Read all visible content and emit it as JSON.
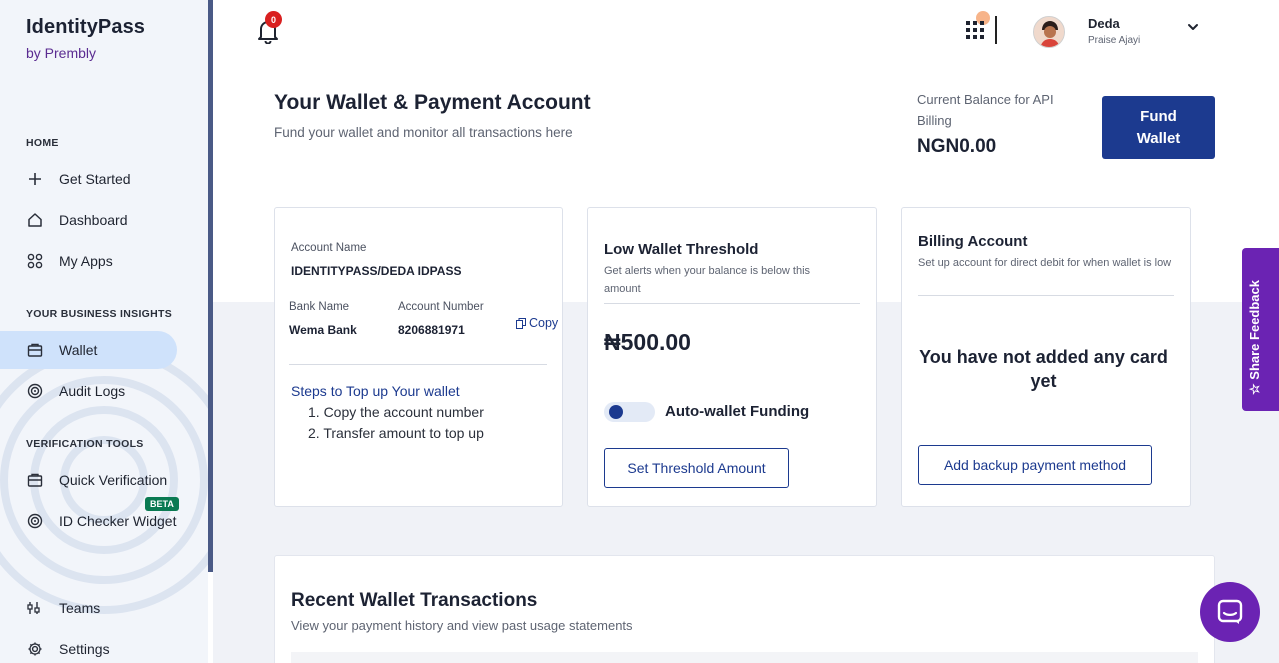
{
  "brand": {
    "name": "IdentityPass",
    "by": "by Prembly"
  },
  "sidebar": {
    "sections": {
      "home": "HOME",
      "insights": "YOUR BUSINESS INSIGHTS",
      "verification": "VERIFICATION TOOLS"
    },
    "items": [
      {
        "label": "Get Started",
        "icon": "plus-icon"
      },
      {
        "label": "Dashboard",
        "icon": "home-icon"
      },
      {
        "label": "My Apps",
        "icon": "apps-icon"
      },
      {
        "label": "Wallet",
        "icon": "wallet-icon",
        "active": true
      },
      {
        "label": "Audit Logs",
        "icon": "target-icon"
      },
      {
        "label": "Quick Verification",
        "icon": "briefcase-icon"
      },
      {
        "label": "ID Checker Widget",
        "icon": "target-icon"
      },
      {
        "label": "Teams",
        "icon": "teams-icon"
      },
      {
        "label": "Settings",
        "icon": "gear-icon"
      }
    ],
    "beta": "BETA"
  },
  "topbar": {
    "notification_count": "0",
    "user_name": "Deda",
    "user_sub": "Praise Ajayi"
  },
  "header": {
    "title": "Your Wallet & Payment Account",
    "subtitle": "Fund your wallet and monitor all transactions here",
    "balance_label": "Current Balance for API Billing",
    "balance_value": "NGN0.00",
    "fund_button": "Fund Wallet"
  },
  "account_card": {
    "account_name_label": "Account Name",
    "account_name": "IDENTITYPASS/DEDA IDPASS",
    "bank_name_label": "Bank Name",
    "bank_name": "Wema Bank",
    "account_number_label": "Account Number",
    "account_number": "8206881971",
    "copy_label": "Copy",
    "steps_title": "Steps to Top up Your wallet",
    "steps": [
      "1. Copy the account number",
      "2. Transfer amount to top up"
    ]
  },
  "threshold_card": {
    "title": "Low Wallet Threshold",
    "desc": "Get alerts when your balance is below this amount",
    "amount": "₦500.00",
    "toggle_label": "Auto-wallet Funding",
    "button": "Set Threshold Amount"
  },
  "billing_card": {
    "title": "Billing Account",
    "desc": "Set up account for direct debit for when wallet is low",
    "empty": "You have not added any card yet",
    "button": "Add backup payment method"
  },
  "transactions": {
    "title": "Recent Wallet Transactions",
    "subtitle": "View your payment history and view past usage statements"
  },
  "feedback": {
    "label": "Share Feedback"
  },
  "colors": {
    "primary": "#1c3a8f",
    "accent": "#6b23b3",
    "active_bg": "#cfe2fb"
  }
}
